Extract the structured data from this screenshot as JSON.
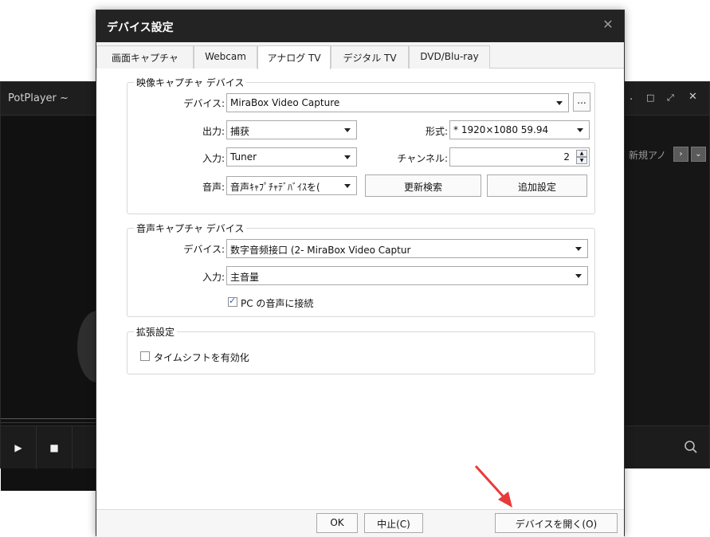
{
  "background_app": {
    "brand": "PotPlayer ~",
    "toolbar_label": "新規アノ",
    "controls": [
      "play",
      "stop"
    ]
  },
  "dialog": {
    "title": "デバイス設定",
    "tabs": [
      "画面キャプチャ",
      "Webcam",
      "アナログ TV",
      "デジタル TV",
      "DVD/Blu-ray"
    ],
    "active_tab": "アナログ TV",
    "video_group": {
      "title": "映像キャプチャ デバイス",
      "device_label": "デバイス:",
      "device_value": "MiraBox Video Capture",
      "more_button": "...",
      "output_label": "出力:",
      "output_value": "捕获",
      "format_label": "形式:",
      "format_value": "* 1920×1080 59.94",
      "input_label": "入力:",
      "input_value": "Tuner",
      "channel_label": "チャンネル:",
      "channel_value": "2",
      "audio_label": "音声:",
      "audio_value": "音声ｷｬﾌﾟﾁｬﾃﾞﾊﾞｲｽを(",
      "rescan_button": "更新検索",
      "additional_button": "追加設定"
    },
    "audio_group": {
      "title": "音声キャプチャ デバイス",
      "device_label": "デバイス:",
      "device_value": "数字音频接口 (2- MiraBox Video Captur",
      "input_label": "入力:",
      "input_value": "主音量",
      "pc_audio_label": "PC の音声に接続",
      "pc_audio_checked": true
    },
    "ext_group": {
      "title": "拡張設定",
      "timeshift_label": "タイムシフトを有効化",
      "timeshift_checked": false
    },
    "footer": {
      "ok": "OK",
      "cancel": "中止(C)",
      "open_device": "デバイスを開く(O)"
    },
    "arrow_color": "#e83a3a"
  }
}
